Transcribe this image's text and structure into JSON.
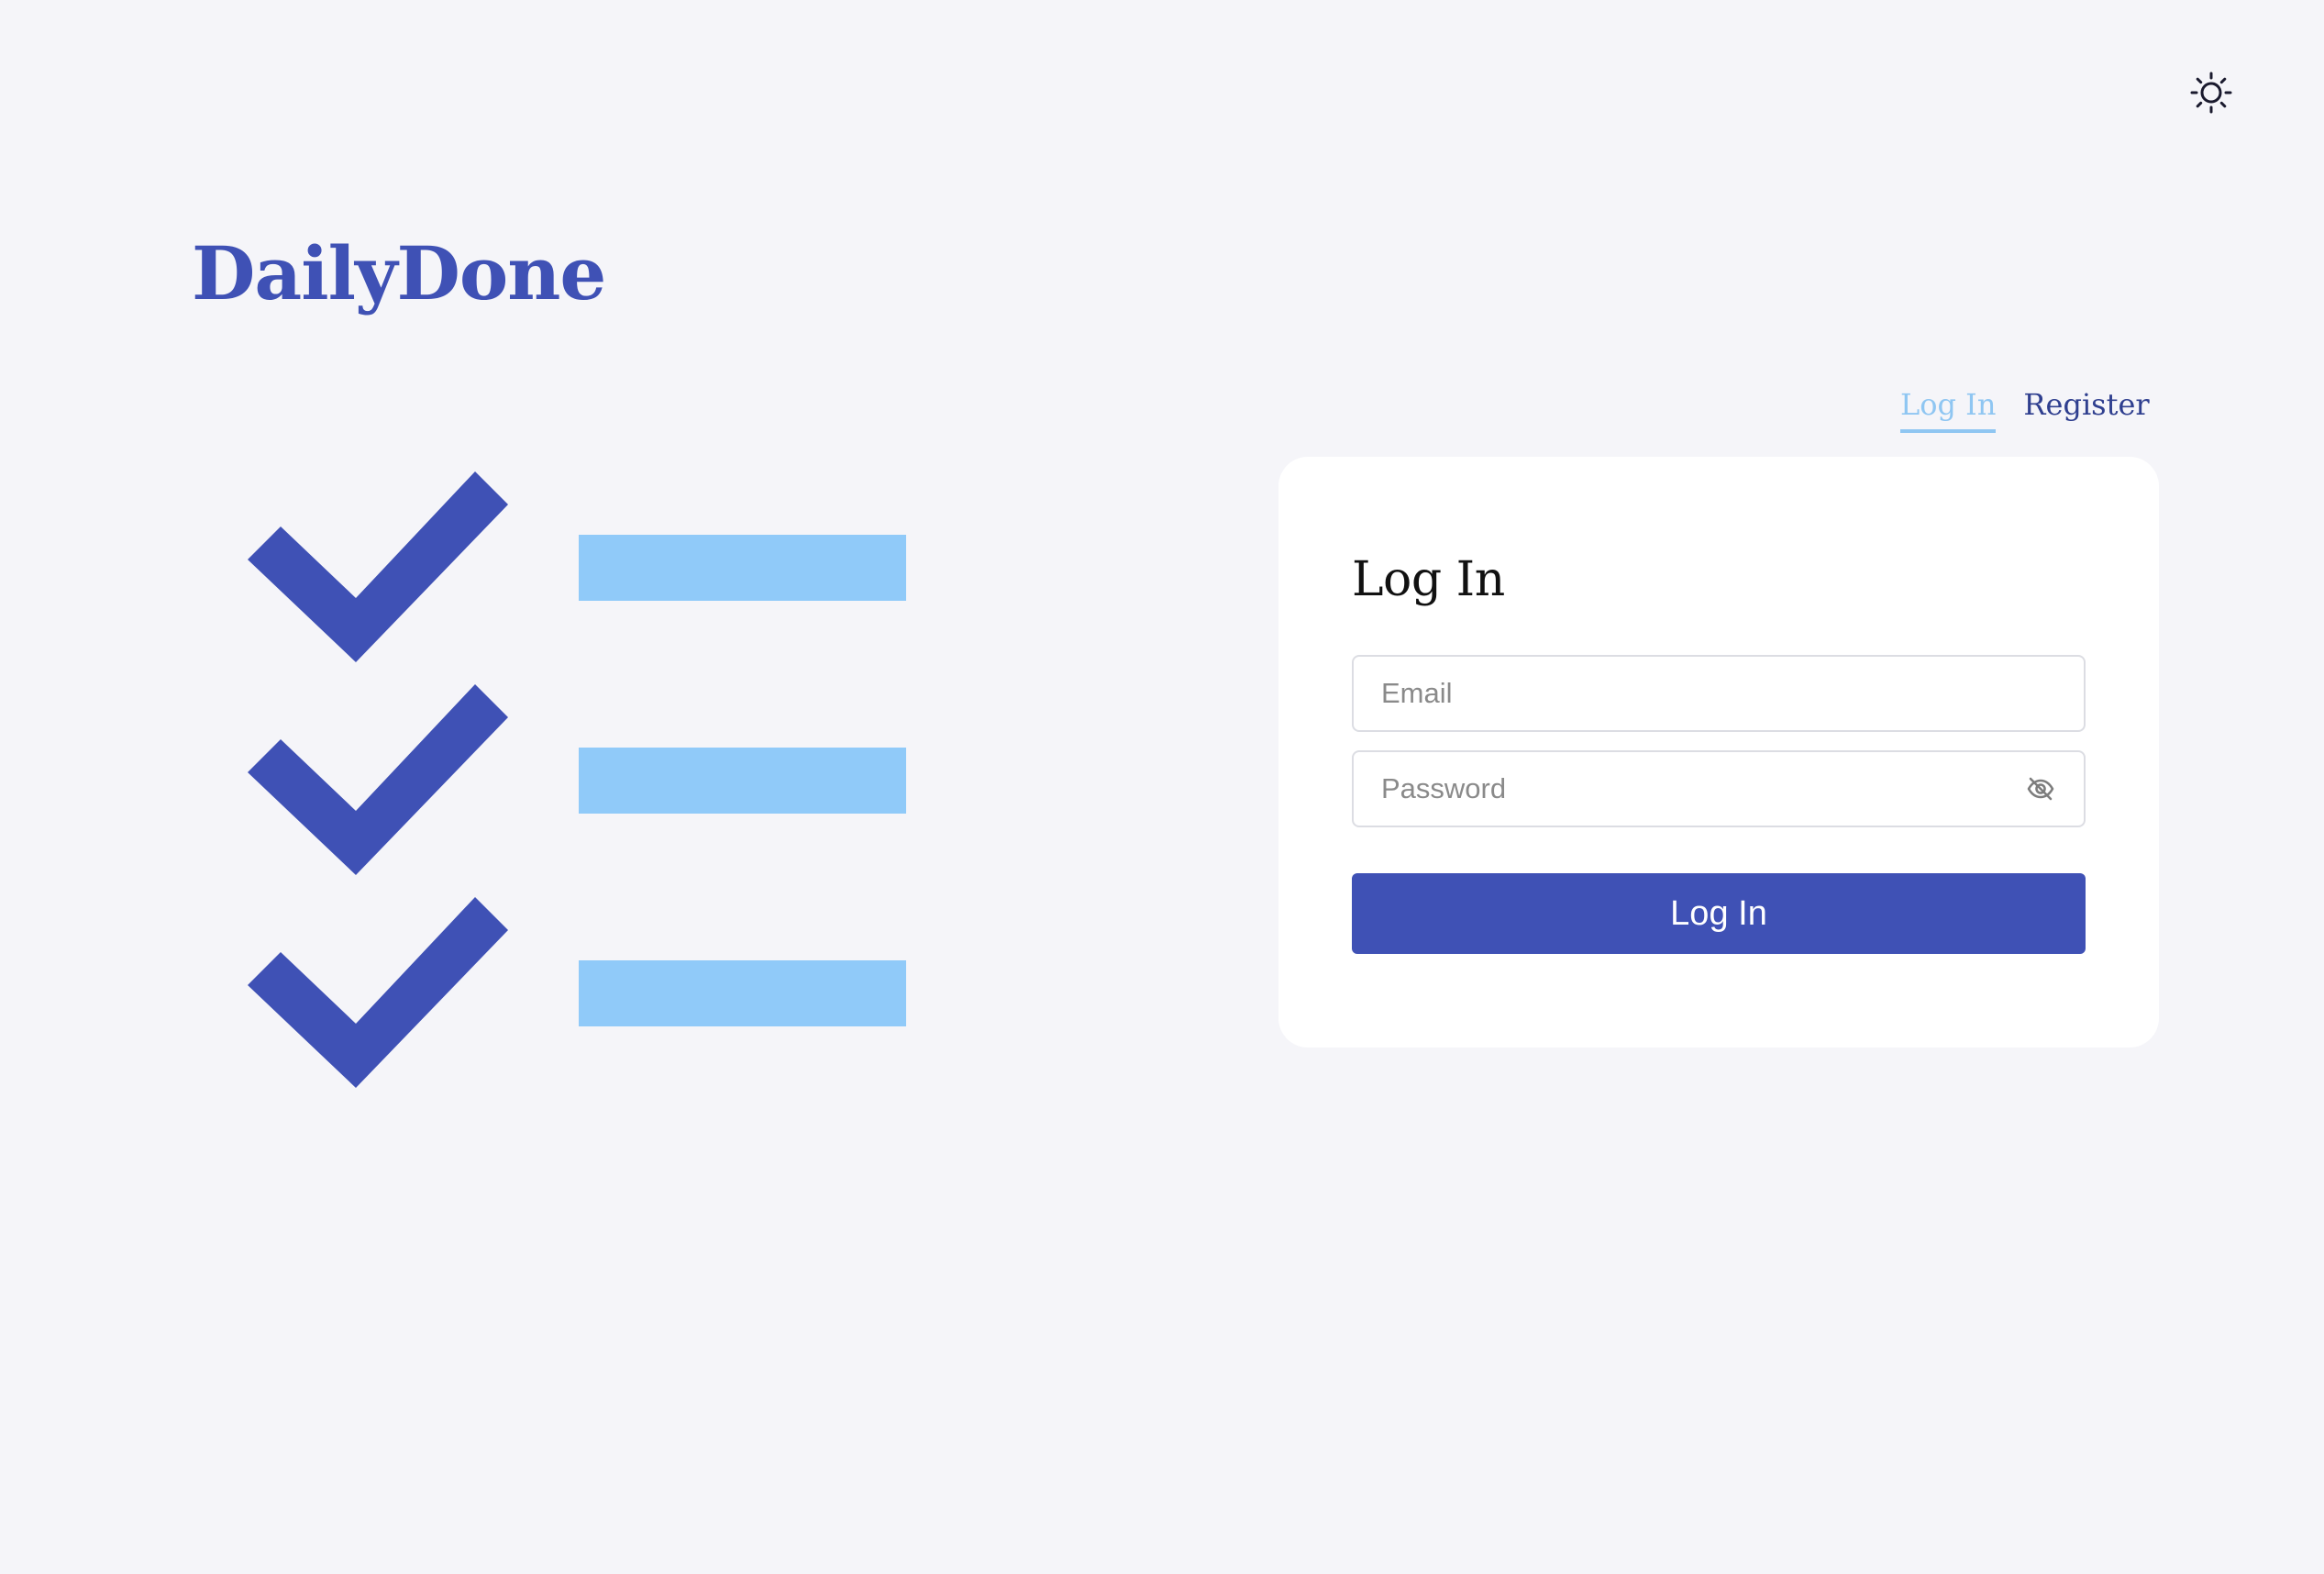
{
  "brand": {
    "name": "DailyDone"
  },
  "theme_toggle": {
    "icon": "sun-icon"
  },
  "illustration": {
    "check_color": "#3f51b5",
    "bar_color": "#90caf9"
  },
  "auth_tabs": [
    {
      "label": "Log In",
      "active": true
    },
    {
      "label": "Register",
      "active": false
    }
  ],
  "form": {
    "title": "Log In",
    "email": {
      "placeholder": "Email",
      "value": ""
    },
    "password": {
      "placeholder": "Password",
      "value": "",
      "toggle_icon": "eye-off-icon"
    },
    "submit_label": "Log In"
  },
  "colors": {
    "primary": "#3f51b5",
    "accent": "#90caf9",
    "background": "#f5f5f9",
    "card": "#ffffff"
  }
}
